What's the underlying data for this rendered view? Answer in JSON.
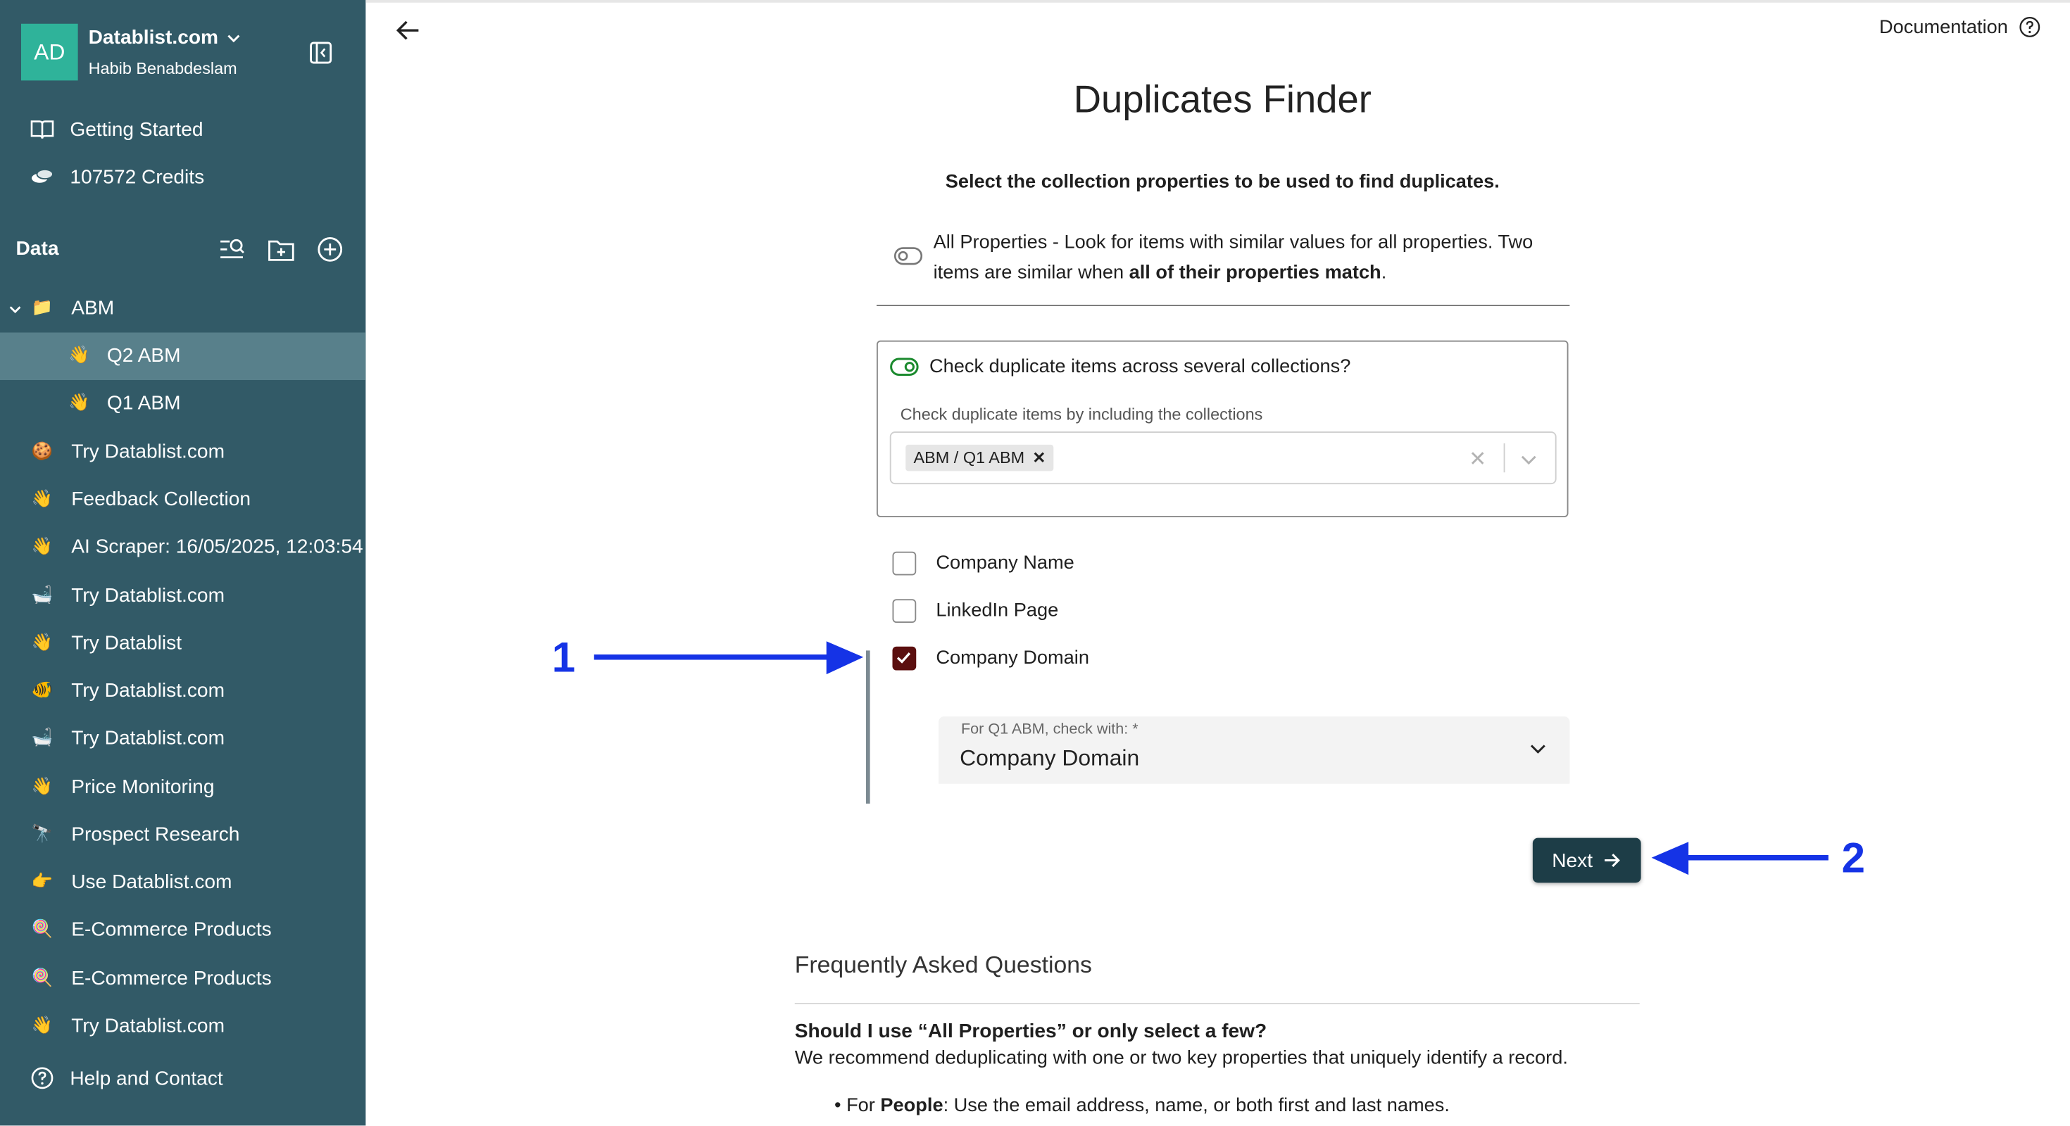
{
  "account": {
    "initials": "AD",
    "name": "Datablist.com",
    "user": "Habib Benabdeslam"
  },
  "nav_top": [
    {
      "label": "Getting Started",
      "icon": "book-icon"
    },
    {
      "label": "107572 Credits",
      "icon": "coins-icon"
    }
  ],
  "data_section": {
    "label": "Data"
  },
  "tree": [
    {
      "label": "ABM",
      "icon": "📁"
    },
    {
      "label": "Q2 ABM",
      "icon": "👋"
    },
    {
      "label": "Q1 ABM",
      "icon": "👋"
    },
    {
      "label": "Try Datablist.com",
      "icon": "🍪"
    },
    {
      "label": "Feedback Collection",
      "icon": "👋"
    },
    {
      "label": "AI Scraper: 16/05/2025, 12:03:54",
      "icon": "👋"
    },
    {
      "label": "Try Datablist.com",
      "icon": "🛁"
    },
    {
      "label": "Try Datablist",
      "icon": "👋"
    },
    {
      "label": "Try Datablist.com",
      "icon": "🐠"
    },
    {
      "label": "Try Datablist.com",
      "icon": "🛁"
    },
    {
      "label": "Price Monitoring",
      "icon": "👋"
    },
    {
      "label": "Prospect Research",
      "icon": "🔭"
    },
    {
      "label": "Use Datablist.com",
      "icon": "👉"
    },
    {
      "label": "E-Commerce Products",
      "icon": "🍭"
    },
    {
      "label": "E-Commerce Products",
      "icon": "🍭"
    },
    {
      "label": "Try Datablist.com",
      "icon": "👋"
    }
  ],
  "help": {
    "label": "Help and Contact"
  },
  "header": {
    "documentation": "Documentation"
  },
  "main": {
    "title": "Duplicates Finder",
    "subtitle": "Select the collection properties to be used to find duplicates.",
    "all_properties_text": "All Properties - Look for items with similar values for all properties. Two items are similar when ",
    "all_properties_bold": "all of their properties match",
    "all_properties_end": ".",
    "cross_question": "Check duplicate items across several collections?",
    "cross_label": "Check duplicate items by including the collections",
    "chip": "ABM / Q1 ABM",
    "properties": [
      {
        "label": "Company Name",
        "checked": false
      },
      {
        "label": "LinkedIn Page",
        "checked": false
      },
      {
        "label": "Company Domain",
        "checked": true
      }
    ],
    "match_label": "For Q1 ABM, check with: *",
    "match_value": "Company Domain",
    "next": "Next"
  },
  "annotations": {
    "one": "1",
    "two": "2",
    "color": "#1533e6"
  },
  "faq": {
    "title": "Frequently Asked Questions",
    "q1": "Should I use “All Properties” or only select a few?",
    "a1": "We recommend deduplicating with one or two key properties that uniquely identify a record.",
    "li_bold": "People",
    "li_prefix": "For ",
    "li_rest": ": Use the email address, name, or both first and last names."
  }
}
